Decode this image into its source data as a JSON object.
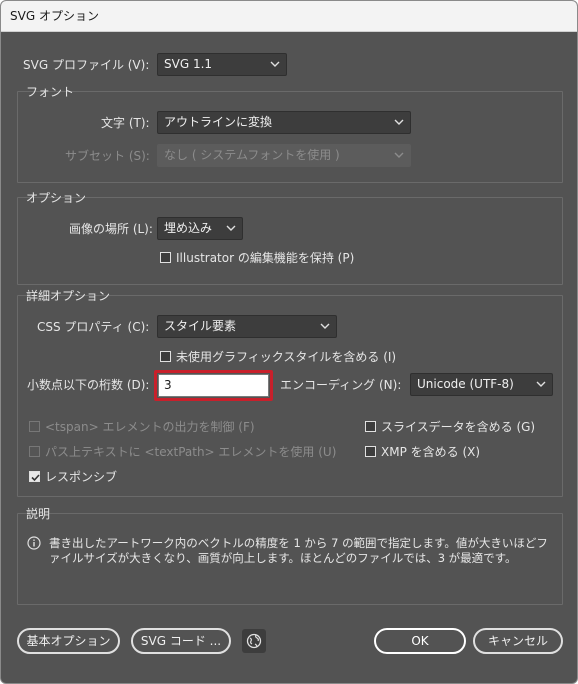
{
  "window": {
    "title": "SVG オプション"
  },
  "profile": {
    "label": "SVG プロファイル (V):",
    "value": "SVG 1.1"
  },
  "font_group": {
    "title": "フォント",
    "type_label": "文字 (T):",
    "type_value": "アウトラインに変換",
    "subset_label": "サブセット (S):",
    "subset_value": "なし ( システムフォントを使用 )"
  },
  "options_group": {
    "title": "オプション",
    "image_location_label": "画像の場所 (L):",
    "image_location_value": "埋め込み",
    "preserve_editing_label": "Illustrator の編集機能を保持 (P)",
    "preserve_editing_checked": false
  },
  "advanced_group": {
    "title": "詳細オプション",
    "css_label": "CSS プロパティ (C):",
    "css_value": "スタイル要素",
    "unused_styles_label": "未使用グラフィックスタイルを含める (I)",
    "unused_styles_checked": false,
    "decimal_label": "小数点以下の桁数 (D):",
    "decimal_value": "3",
    "encoding_label": "エンコーディング (N):",
    "encoding_value": "Unicode (UTF-8)",
    "tspan_label": "<tspan> エレメントの出力を制御 (F)",
    "textpath_label": "パス上テキストに <textPath> エレメントを使用 (U)",
    "responsive_label": "レスポンシブ",
    "responsive_checked": true,
    "slice_data_label": "スライスデータを含める (G)",
    "xmp_label": "XMP を含める (X)"
  },
  "description_group": {
    "title": "説明",
    "text": "書き出したアートワーク内のベクトルの精度を 1 から 7 の範囲で指定します。値が大きいほどファイルサイズが大きくなり、画質が向上します。ほとんどのファイルでは、3 が最適です。"
  },
  "buttons": {
    "basic_options": "基本オプション",
    "svg_code": "SVG コード ...",
    "ok": "OK",
    "cancel": "キャンセル"
  }
}
